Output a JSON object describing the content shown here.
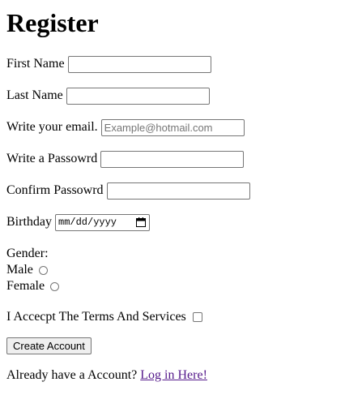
{
  "page": {
    "title": "Register"
  },
  "form": {
    "first_name": {
      "label": "First Name",
      "value": "",
      "placeholder": ""
    },
    "last_name": {
      "label": "Last Name",
      "value": "",
      "placeholder": ""
    },
    "email": {
      "label": "Write your email.",
      "value": "",
      "placeholder": "Example@hotmail.com"
    },
    "password": {
      "label": "Write a Passowrd",
      "value": "",
      "placeholder": ""
    },
    "confirm_password": {
      "label": "Confirm Passowrd",
      "value": "",
      "placeholder": ""
    },
    "birthday": {
      "label": "Birthday",
      "placeholder": "mm/dd/yyyy",
      "icon": "calendar-icon"
    },
    "gender": {
      "label": "Gender:",
      "options": [
        {
          "label": "Male",
          "selected": false
        },
        {
          "label": "Female",
          "selected": false
        }
      ]
    },
    "terms": {
      "label": "I Accecpt The Terms And Services",
      "checked": false
    },
    "submit_label": "Create Account"
  },
  "footer": {
    "text": "Already have a Account?",
    "link_label": "Log in Here!"
  }
}
